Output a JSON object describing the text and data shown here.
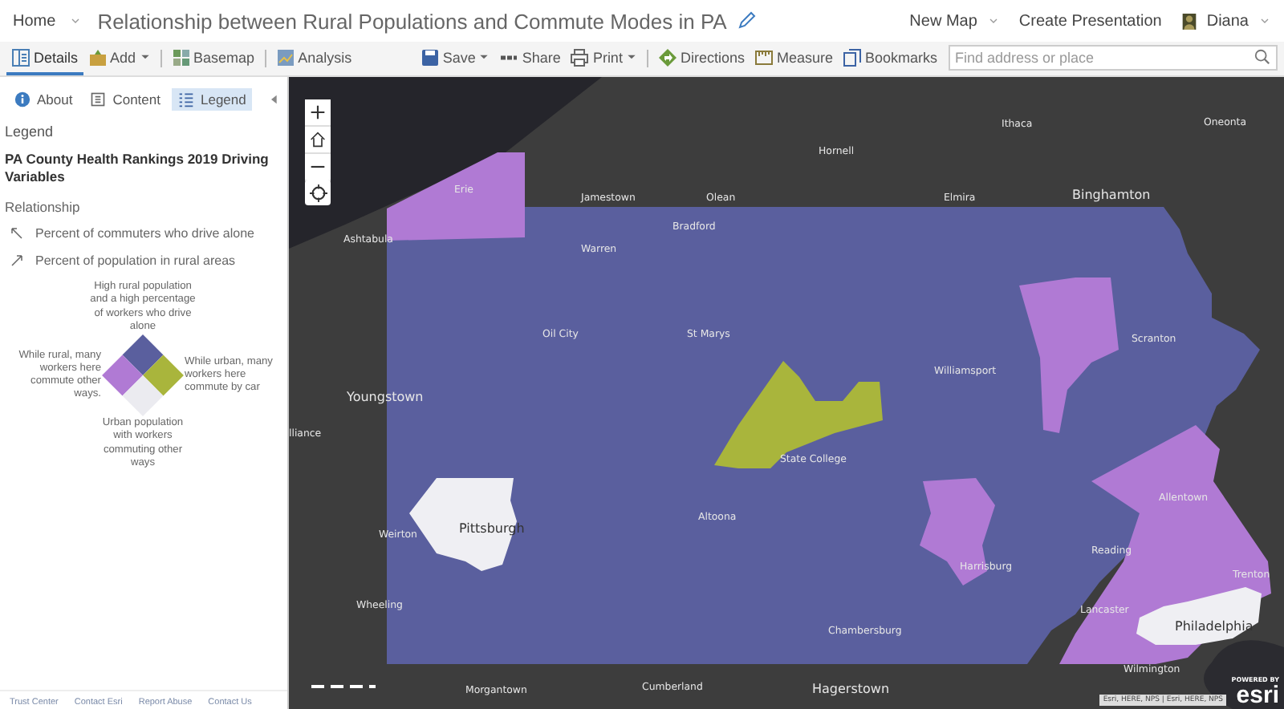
{
  "header": {
    "home": "Home",
    "title": "Relationship between Rural Populations and Commute Modes in PA",
    "links": [
      {
        "label": "New Map",
        "dropdown": true
      },
      {
        "label": "Create Presentation",
        "dropdown": false
      }
    ],
    "user": "Diana"
  },
  "toolbar": {
    "left": [
      {
        "label": "Details",
        "dropdown": false,
        "selected": true
      },
      {
        "label": "Add",
        "dropdown": true,
        "selected": false
      },
      {
        "label": "Basemap",
        "dropdown": false,
        "selected": false
      },
      {
        "label": "Analysis",
        "dropdown": false,
        "selected": false
      }
    ],
    "right": [
      {
        "label": "Save",
        "dropdown": true
      },
      {
        "label": "Share",
        "dropdown": false
      },
      {
        "label": "Print",
        "dropdown": true
      },
      {
        "label": "Directions",
        "dropdown": false
      },
      {
        "label": "Measure",
        "dropdown": false
      },
      {
        "label": "Bookmarks",
        "dropdown": false
      }
    ],
    "search": {
      "placeholder": "Find address or place"
    }
  },
  "panel": {
    "tabs": [
      {
        "label": "About",
        "selected": false
      },
      {
        "label": "Content",
        "selected": false
      },
      {
        "label": "Legend",
        "selected": true
      }
    ],
    "heading": "Legend",
    "layer_title": "PA County Health Rankings 2019 Driving Variables",
    "group": "Relationship",
    "items": [
      {
        "label": "Percent of commuters who drive alone",
        "kind": "up-left"
      },
      {
        "label": "Percent of population in rural areas",
        "kind": "up-right"
      }
    ],
    "diagram": {
      "top": "High rural population and a high percentage of workers who drive alone",
      "left": "While rural, many workers here commute other ways.",
      "right": "While urban, many workers here commute by car",
      "bottom": "Urban population with workers commuting other ways"
    },
    "footer": [
      "Trust Center",
      "Contact Esri",
      "Report Abuse",
      "Contact Us"
    ]
  },
  "map": {
    "regions": [
      {
        "kind": "state",
        "color": "#5a5f9e"
      },
      {
        "kind": "erie",
        "color": "#b07ad4"
      },
      {
        "kind": "scranton",
        "color": "#b07ad4"
      },
      {
        "kind": "southeast",
        "color": "#b07ad4"
      },
      {
        "kind": "harrisburg",
        "color": "#b07ad4"
      },
      {
        "kind": "pittsburgh",
        "color": "#efeff3"
      },
      {
        "kind": "philadelphia",
        "color": "#efeff3"
      },
      {
        "kind": "centre",
        "color": "#a9b53c"
      }
    ],
    "places": [
      "Ithaca",
      "Oneonta",
      "Hornell",
      "Jamestown",
      "Olean",
      "Elmira",
      "Binghamton",
      "Erie",
      "Ashtabula",
      "Bradford",
      "Warren",
      "Oil City",
      "St Marys",
      "Scranton",
      "Williamsport",
      "Youngstown",
      "lliance",
      "State College",
      "Pittsburgh",
      "Weirton",
      "Altoona",
      "Allentown",
      "Reading",
      "Harrisburg",
      "Trenton",
      "Wheeling",
      "Lancaster",
      "Chambersburg",
      "Philadelphia",
      "Wilmington",
      "Morgantown",
      "Cumberland",
      "Hagerstown"
    ],
    "attribution": "Esri, HERE, NPS | Esri, HERE, NPS",
    "powered_by": "POWERED BY",
    "logo": "esri"
  }
}
